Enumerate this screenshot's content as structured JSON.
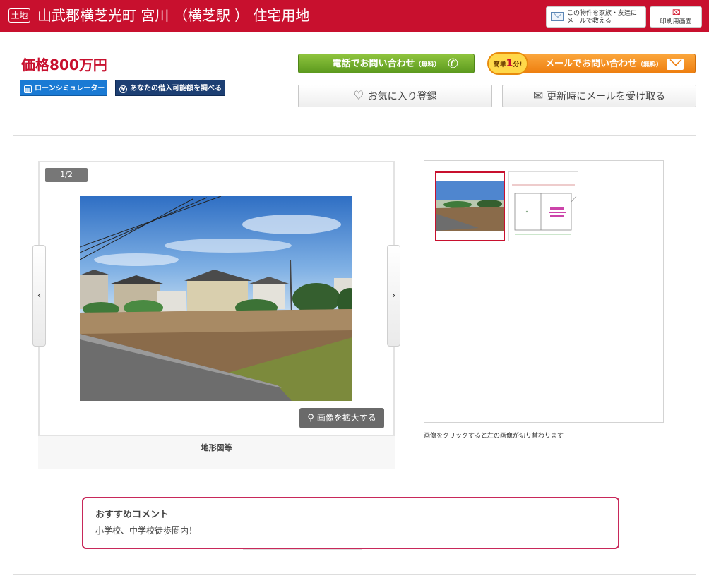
{
  "header": {
    "type_badge": "土地",
    "title": "山武郡横芝光町 宮川 （横芝駅 ） 住宅用地",
    "share_label": "この物件を家族・友達に\nメールで教える",
    "print_label": "印刷用画面"
  },
  "price": "価格800万円",
  "tools": {
    "loan_label": "ローンシミュレーター",
    "borrow_label": "あなたの借入可能額を調べる"
  },
  "contact": {
    "phone_label": "電話でお問い合わせ",
    "phone_note": "（無料）",
    "mail_badge_prefix": "簡単",
    "mail_badge_num": "1",
    "mail_badge_suffix": "分!",
    "mail_label": "メールでお問い合わせ",
    "mail_note": "（無料）"
  },
  "actions": {
    "favorite_label": "お気に入り登録",
    "notify_label": "更新時にメールを受け取る"
  },
  "gallery": {
    "counter": "1/2",
    "prev": "‹",
    "next": "›",
    "zoom_label": "画像を拡大する",
    "caption": "地形図等",
    "thumb_note": "画像をクリックすると左の画像が切り替わります"
  },
  "comment": {
    "title": "おすすめコメント",
    "text": "小学校、中学校徒歩圏内！"
  },
  "colors": {
    "brand": "#c8102e",
    "phone": "#6aa72a",
    "mail": "#f28c1d",
    "loan": "#1a7ad4",
    "borrow": "#1d3f73"
  },
  "icons": {
    "share": "mail-icon",
    "print": "pdf-icon",
    "phone": "phone-icon",
    "mail": "envelope-icon",
    "favorite": "heart-icon",
    "notify": "mail-open-icon",
    "zoom": "magnifier-icon",
    "loan": "calculator-icon",
    "borrow": "yen-icon"
  }
}
